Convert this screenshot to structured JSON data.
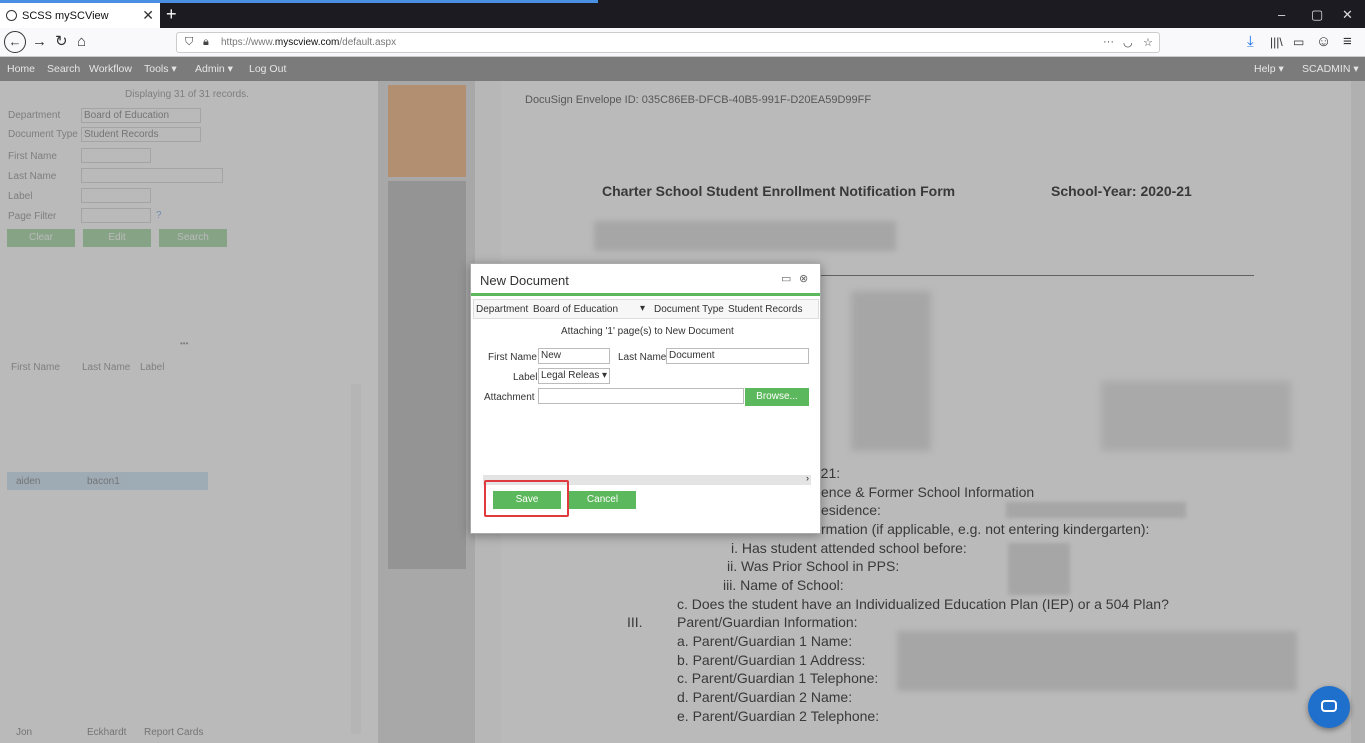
{
  "browser": {
    "tab_title": "SCSS mySCView",
    "tab_close": "✕",
    "new_tab": "+",
    "url_prefix": "https://www.",
    "url_domain": "myscview.com",
    "url_path": "/default.aspx",
    "min": "–",
    "max": "▢",
    "close": "✕"
  },
  "appnav": {
    "items": [
      "Home",
      "Search",
      "Workflow",
      "Tools ▾",
      "Admin ▾",
      "Log Out"
    ],
    "right_items": [
      "Help ▾",
      "SCADMIN ▾"
    ]
  },
  "search_panel": {
    "record_info": "Displaying 31 of 31 records.",
    "department_label": "Department",
    "department_value": "Board of Education",
    "doc_type_label": "Document Type",
    "doc_type_value": "Student Records",
    "first_name_label": "First Name",
    "last_name_label": "Last Name",
    "label_label": "Label",
    "page_filter_label": "Page Filter",
    "help_mark": "?",
    "clear_button": "Clear",
    "edit_button": "Edit",
    "search_button": "Search",
    "splitter": "•••"
  },
  "grid": {
    "columns": [
      "First Name",
      "Last Name",
      "Label"
    ],
    "selected_row": {
      "first": "aiden",
      "last": "bacon1",
      "label": ""
    },
    "last_row": {
      "first": "Jon",
      "last": "Eckhardt",
      "label": "Report Cards"
    }
  },
  "document": {
    "envelope_id": "DocuSign Envelope ID: 035C86EB-DFCB-40B5-991F-D20EA59D99FF",
    "form_title": "Charter School Student Enrollment Notification Form",
    "school_year": "School-Year: 2020-21",
    "lines": [
      "-21:",
      "ence & Former School Information",
      "esidence:",
      "rmation (if applicable, e.g. not entering kindergarten):",
      "i.   Has student attended school before:",
      "ii.   Was Prior School in PPS:",
      "iii.   Name of School:",
      "c.   Does the student have an Individualized Education Plan (IEP) or a 504 Plan?",
      "III.",
      "Parent/Guardian Information:",
      "a.   Parent/Guardian 1 Name:",
      "b.   Parent/Guardian 1 Address:",
      "c.   Parent/Guardian 1 Telephone:",
      "d.   Parent/Guardian 2 Name:",
      "e.   Parent/Guardian 2 Telephone:"
    ]
  },
  "dialog": {
    "title": "New Document",
    "department_label": "Department",
    "department_value": "Board of Education",
    "doc_type_label": "Document Type",
    "doc_type_value": "Student Records",
    "attaching_text": "Attaching '1' page(s) to New Document",
    "first_name_label": "First Name",
    "first_name_value": "New",
    "last_name_label": "Last Name",
    "last_name_value": "Document",
    "label_label": "Label",
    "label_value": "Legal Releas",
    "attachment_label": "Attachment",
    "browse_button": "Browse...",
    "save_button": "Save",
    "cancel_button": "Cancel"
  },
  "colors": {
    "accent_green": "#5cb85c",
    "highlight_red": "#e0393e",
    "chat_blue": "#1f6fcc"
  }
}
